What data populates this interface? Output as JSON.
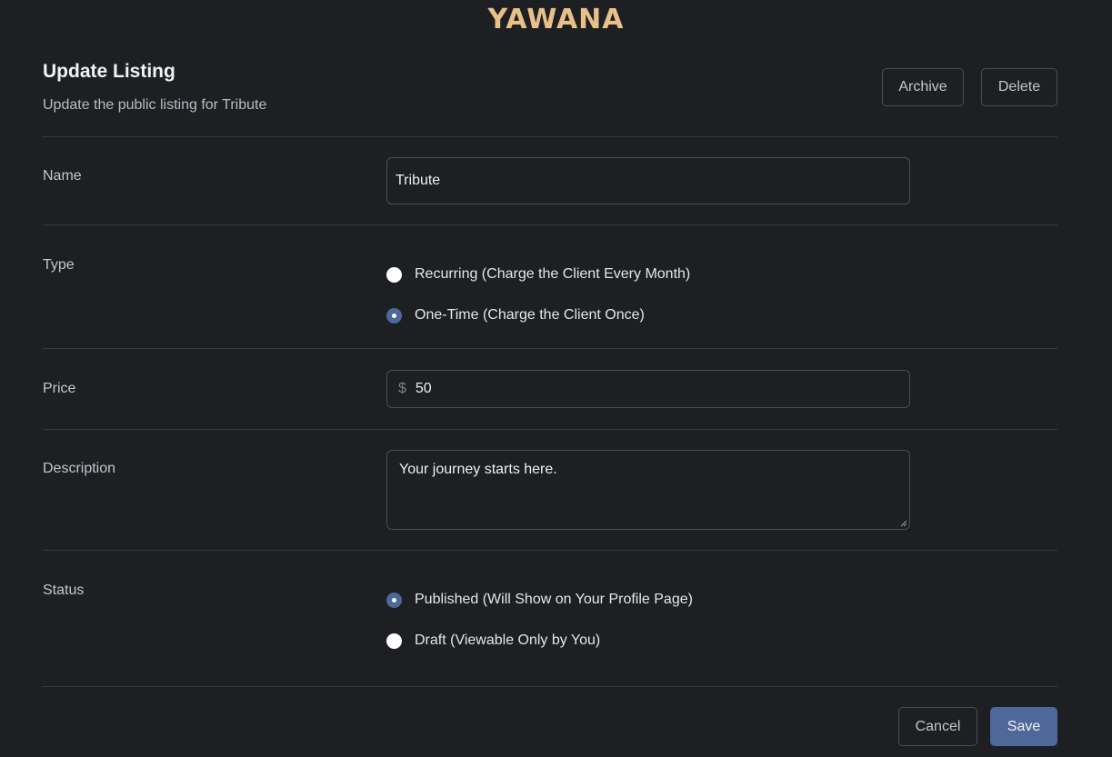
{
  "brand": {
    "logo_text": "YAWANA",
    "accent_color": "#e8c08a",
    "primary_color": "#4d6899"
  },
  "header": {
    "title": "Update Listing",
    "subtitle": "Update the public listing for Tribute",
    "archive_label": "Archive",
    "delete_label": "Delete"
  },
  "form": {
    "name": {
      "label": "Name",
      "value": "Tribute"
    },
    "type": {
      "label": "Type",
      "options": [
        {
          "label": "Recurring (Charge the Client Every Month)",
          "selected": false
        },
        {
          "label": "One-Time (Charge the Client Once)",
          "selected": true
        }
      ]
    },
    "price": {
      "label": "Price",
      "currency_symbol": "$",
      "value": "50"
    },
    "description": {
      "label": "Description",
      "value": "Your journey starts here."
    },
    "status": {
      "label": "Status",
      "options": [
        {
          "label": "Published (Will Show on Your Profile Page)",
          "selected": true
        },
        {
          "label": "Draft (Viewable Only by You)",
          "selected": false
        }
      ]
    }
  },
  "footer": {
    "cancel_label": "Cancel",
    "save_label": "Save"
  }
}
